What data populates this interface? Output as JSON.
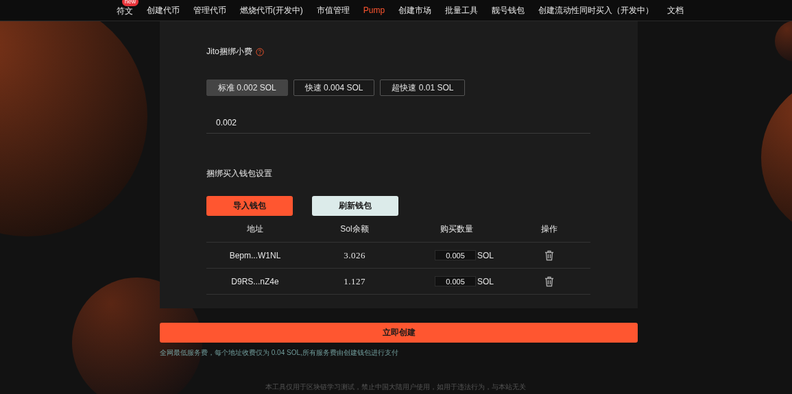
{
  "nav": {
    "items": [
      {
        "label": "符文",
        "selected": false,
        "badge": "new"
      },
      {
        "label": "创建代币",
        "selected": false
      },
      {
        "label": "管理代币",
        "selected": false
      },
      {
        "label": "燃烧代币(开发中)",
        "selected": false
      },
      {
        "label": "市值管理",
        "selected": false
      },
      {
        "label": "Pump",
        "selected": true
      },
      {
        "label": "创建市场",
        "selected": false
      },
      {
        "label": "批量工具",
        "selected": false
      },
      {
        "label": "靓号钱包",
        "selected": false
      },
      {
        "label": "创建流动性同时买入（开发中）",
        "selected": false
      },
      {
        "label": "文档",
        "selected": false
      }
    ]
  },
  "jito": {
    "label": "Jito捆绑小费",
    "options": [
      {
        "label": "标准 0.002 SOL",
        "selected": true
      },
      {
        "label": "快速 0.004 SOL",
        "selected": false
      },
      {
        "label": "超快速 0.01 SOL",
        "selected": false
      }
    ],
    "value": "0.002"
  },
  "wallets": {
    "title": "捆绑买入钱包设置",
    "buttons": [
      {
        "label": "导入钱包",
        "kind": "primary"
      },
      {
        "label": "刷新钱包",
        "kind": "secondary"
      }
    ],
    "table": {
      "columns": [
        "地址",
        "Sol余额",
        "购买数量",
        "操作"
      ],
      "rows": [
        {
          "address": "Bepm...W1NL",
          "balance": "3.026",
          "amount": "0.005",
          "unit": "SOL"
        },
        {
          "address": "D9RS...nZ4e",
          "balance": "1.127",
          "amount": "0.005",
          "unit": "SOL"
        }
      ]
    }
  },
  "create_button": "立即创建",
  "fee_note": "全网最低服务费，每个地址收费仅为 0.04 SOL,所有服务费由创建钱包进行支付",
  "footer": "本工具仅用于区块链学习测试，禁止中国大陆用户使用，如用于违法行为，与本站无关"
}
